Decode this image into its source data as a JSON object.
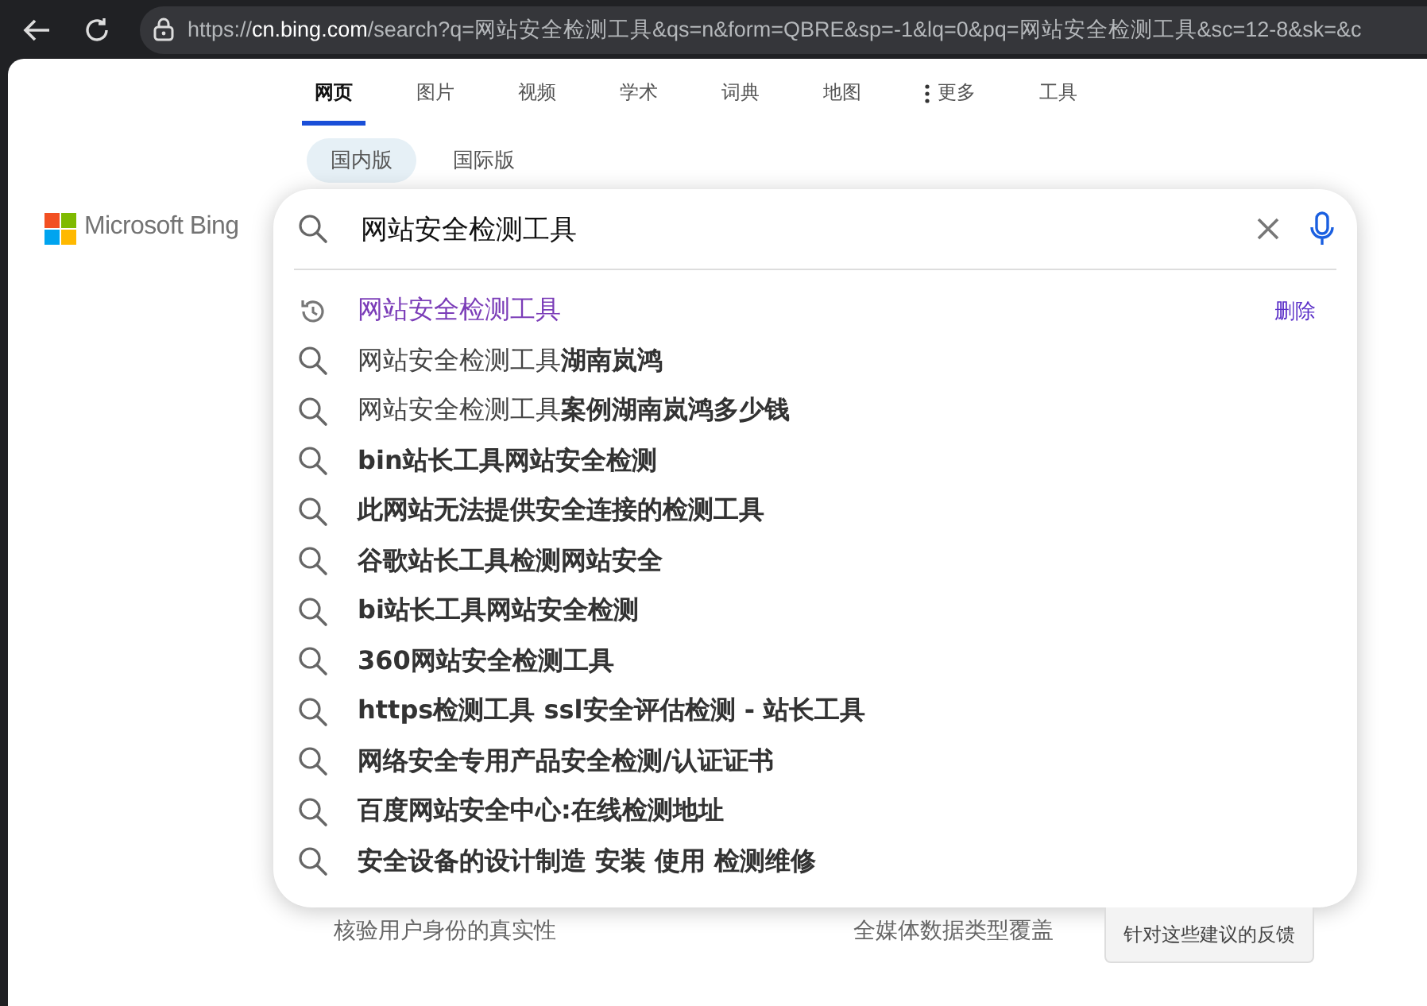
{
  "browser": {
    "url": "https://**cn.bing.com**/search?q=网站安全检测工具&qs=n&form=QBRE&sp=-1&lq=0&pq=网站安全检测工具&sc=12-8&sk=&c"
  },
  "tabs": [
    {
      "label": "网页",
      "selected": true,
      "kind": "plain"
    },
    {
      "label": "图片",
      "selected": false,
      "kind": "plain"
    },
    {
      "label": "视频",
      "selected": false,
      "kind": "plain"
    },
    {
      "label": "学术",
      "selected": false,
      "kind": "plain"
    },
    {
      "label": "词典",
      "selected": false,
      "kind": "plain"
    },
    {
      "label": "地图",
      "selected": false,
      "kind": "plain"
    },
    {
      "label": "更多",
      "selected": false,
      "kind": "more"
    },
    {
      "label": "工具",
      "selected": false,
      "kind": "plain"
    }
  ],
  "regions": [
    {
      "label": "国内版",
      "selected": true
    },
    {
      "label": "国际版",
      "selected": false
    }
  ],
  "logo": {
    "text": "Microsoft Bing"
  },
  "search": {
    "value": "网站安全检测工具"
  },
  "suggestions": [
    {
      "kind": "history",
      "text": "网站安全检测工具",
      "action": "删除"
    },
    {
      "kind": "search",
      "text": "网站安全检测工具**湖南岚鸿**"
    },
    {
      "kind": "search",
      "text": "网站安全检测工具**案例湖南岚鸿多少钱**"
    },
    {
      "kind": "search",
      "text": "**bin站长工具网站安全检测**"
    },
    {
      "kind": "search",
      "text": "**此网站无法提供安全连接的检测工具**"
    },
    {
      "kind": "search",
      "text": "**谷歌站长工具检测网站安全**"
    },
    {
      "kind": "search",
      "text": "**bi站长工具网站安全检测**"
    },
    {
      "kind": "search",
      "text": "**360网站安全检测工具**"
    },
    {
      "kind": "search",
      "text": "**https检测工具 ssl安全评估检测 - 站长工具**"
    },
    {
      "kind": "search",
      "text": "**网络安全专用产品安全检测/认证证书**"
    },
    {
      "kind": "search",
      "text": "**百度网站安全中心:在线检测地址**"
    },
    {
      "kind": "search",
      "text": "**安全设备的设计制造 安装 使用 检测维修**"
    }
  ],
  "below": {
    "texts": [
      "核验用户身份的真实性",
      "全媒体数据类型覆盖"
    ],
    "feedback": "针对这些建议的反馈"
  }
}
